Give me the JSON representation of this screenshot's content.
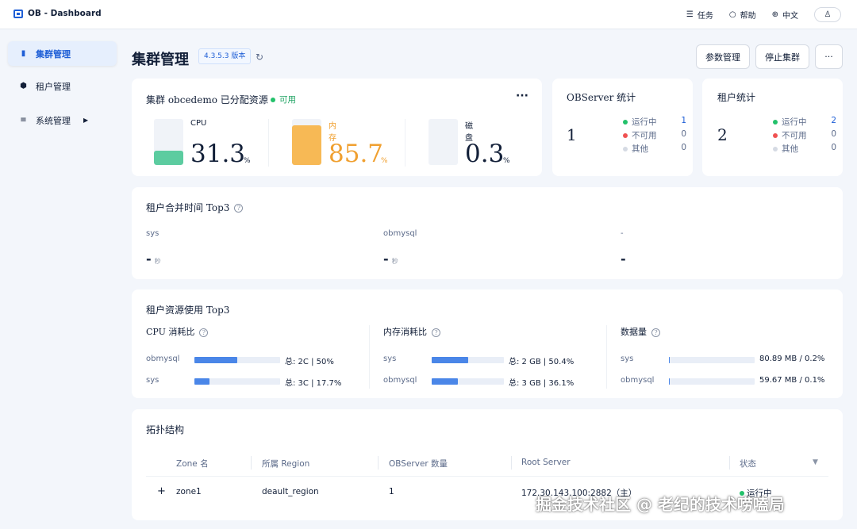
{
  "app": {
    "title": "OB - Dashboard"
  },
  "topbar": {
    "tasks": "任务",
    "help": "帮助",
    "language": "中文"
  },
  "sidebar": {
    "items": [
      {
        "label": "集群管理",
        "icon": "bar-chart-icon"
      },
      {
        "label": "租户管理",
        "icon": "cube-icon"
      },
      {
        "label": "系统管理",
        "icon": "sliders-icon"
      }
    ]
  },
  "header": {
    "title": "集群管理",
    "version": "4.3.5.3 版本",
    "buttons": {
      "params": "参数管理",
      "stop": "停止集群",
      "more": "···"
    }
  },
  "resources": {
    "title": "集群 obcedemo 已分配资源",
    "status": "可用",
    "more": "···",
    "metrics": [
      {
        "label": "CPU",
        "value": "31.3",
        "unit": "%",
        "percent": 31.3,
        "color": "#5ccca0",
        "text_color": "#132039"
      },
      {
        "label": "内存",
        "value": "85.7",
        "unit": "%",
        "percent": 85.7,
        "color": "#f7b955",
        "text_color": "#f0a030"
      },
      {
        "label": "磁盘",
        "value": "0.3",
        "unit": "%",
        "percent": 0.3,
        "color": "#d5dae3",
        "text_color": "#132039"
      }
    ]
  },
  "observer_stats": {
    "title": "OBServer 统计",
    "total": "1",
    "rows": [
      {
        "label": "运行中",
        "value": "1",
        "color": "#23c16b"
      },
      {
        "label": "不可用",
        "value": "0",
        "color": "#f05252"
      },
      {
        "label": "其他",
        "value": "0",
        "color": "#d5dae3"
      }
    ]
  },
  "tenant_stats": {
    "title": "租户统计",
    "total": "2",
    "rows": [
      {
        "label": "运行中",
        "value": "2",
        "color": "#23c16b"
      },
      {
        "label": "不可用",
        "value": "0",
        "color": "#f05252"
      },
      {
        "label": "其他",
        "value": "0",
        "color": "#d5dae3"
      }
    ]
  },
  "merge_top3": {
    "title": "租户合并时间 Top3",
    "help": "?",
    "items": [
      {
        "name": "sys",
        "value": "-",
        "unit": "秒"
      },
      {
        "name": "obmysql",
        "value": "-",
        "unit": "秒"
      },
      {
        "name": "-",
        "value": "-",
        "unit": ""
      }
    ]
  },
  "resource_top3": {
    "title": "租户资源使用 Top3",
    "groups": [
      {
        "title": "CPU 消耗比",
        "rows": [
          {
            "name": "obmysql",
            "percent": 50,
            "text": "总: 2C | 50%"
          },
          {
            "name": "sys",
            "percent": 17.7,
            "text": "总: 3C | 17.7%"
          }
        ]
      },
      {
        "title": "内存消耗比",
        "rows": [
          {
            "name": "sys",
            "percent": 50.4,
            "text": "总: 2 GB | 50.4%"
          },
          {
            "name": "obmysql",
            "percent": 36.1,
            "text": "总: 3 GB | 36.1%"
          }
        ]
      },
      {
        "title": "数据量",
        "rows": [
          {
            "name": "sys",
            "percent": 0.2,
            "text": "80.89 MB / 0.2%"
          },
          {
            "name": "obmysql",
            "percent": 0.1,
            "text": "59.67 MB / 0.1%"
          }
        ]
      }
    ]
  },
  "topology": {
    "title": "拓扑结构",
    "columns": [
      "Zone 名",
      "所属 Region",
      "OBServer 数量",
      "Root Server",
      "状态"
    ],
    "rows": [
      {
        "expand": "+",
        "zone": "zone1",
        "region": "deault_region",
        "count": "1",
        "root": "172.30.143.100:2882（主）",
        "status": "运行中"
      }
    ]
  },
  "watermark": "掘金技术社区 @ 老纪的技术唠嗑局"
}
